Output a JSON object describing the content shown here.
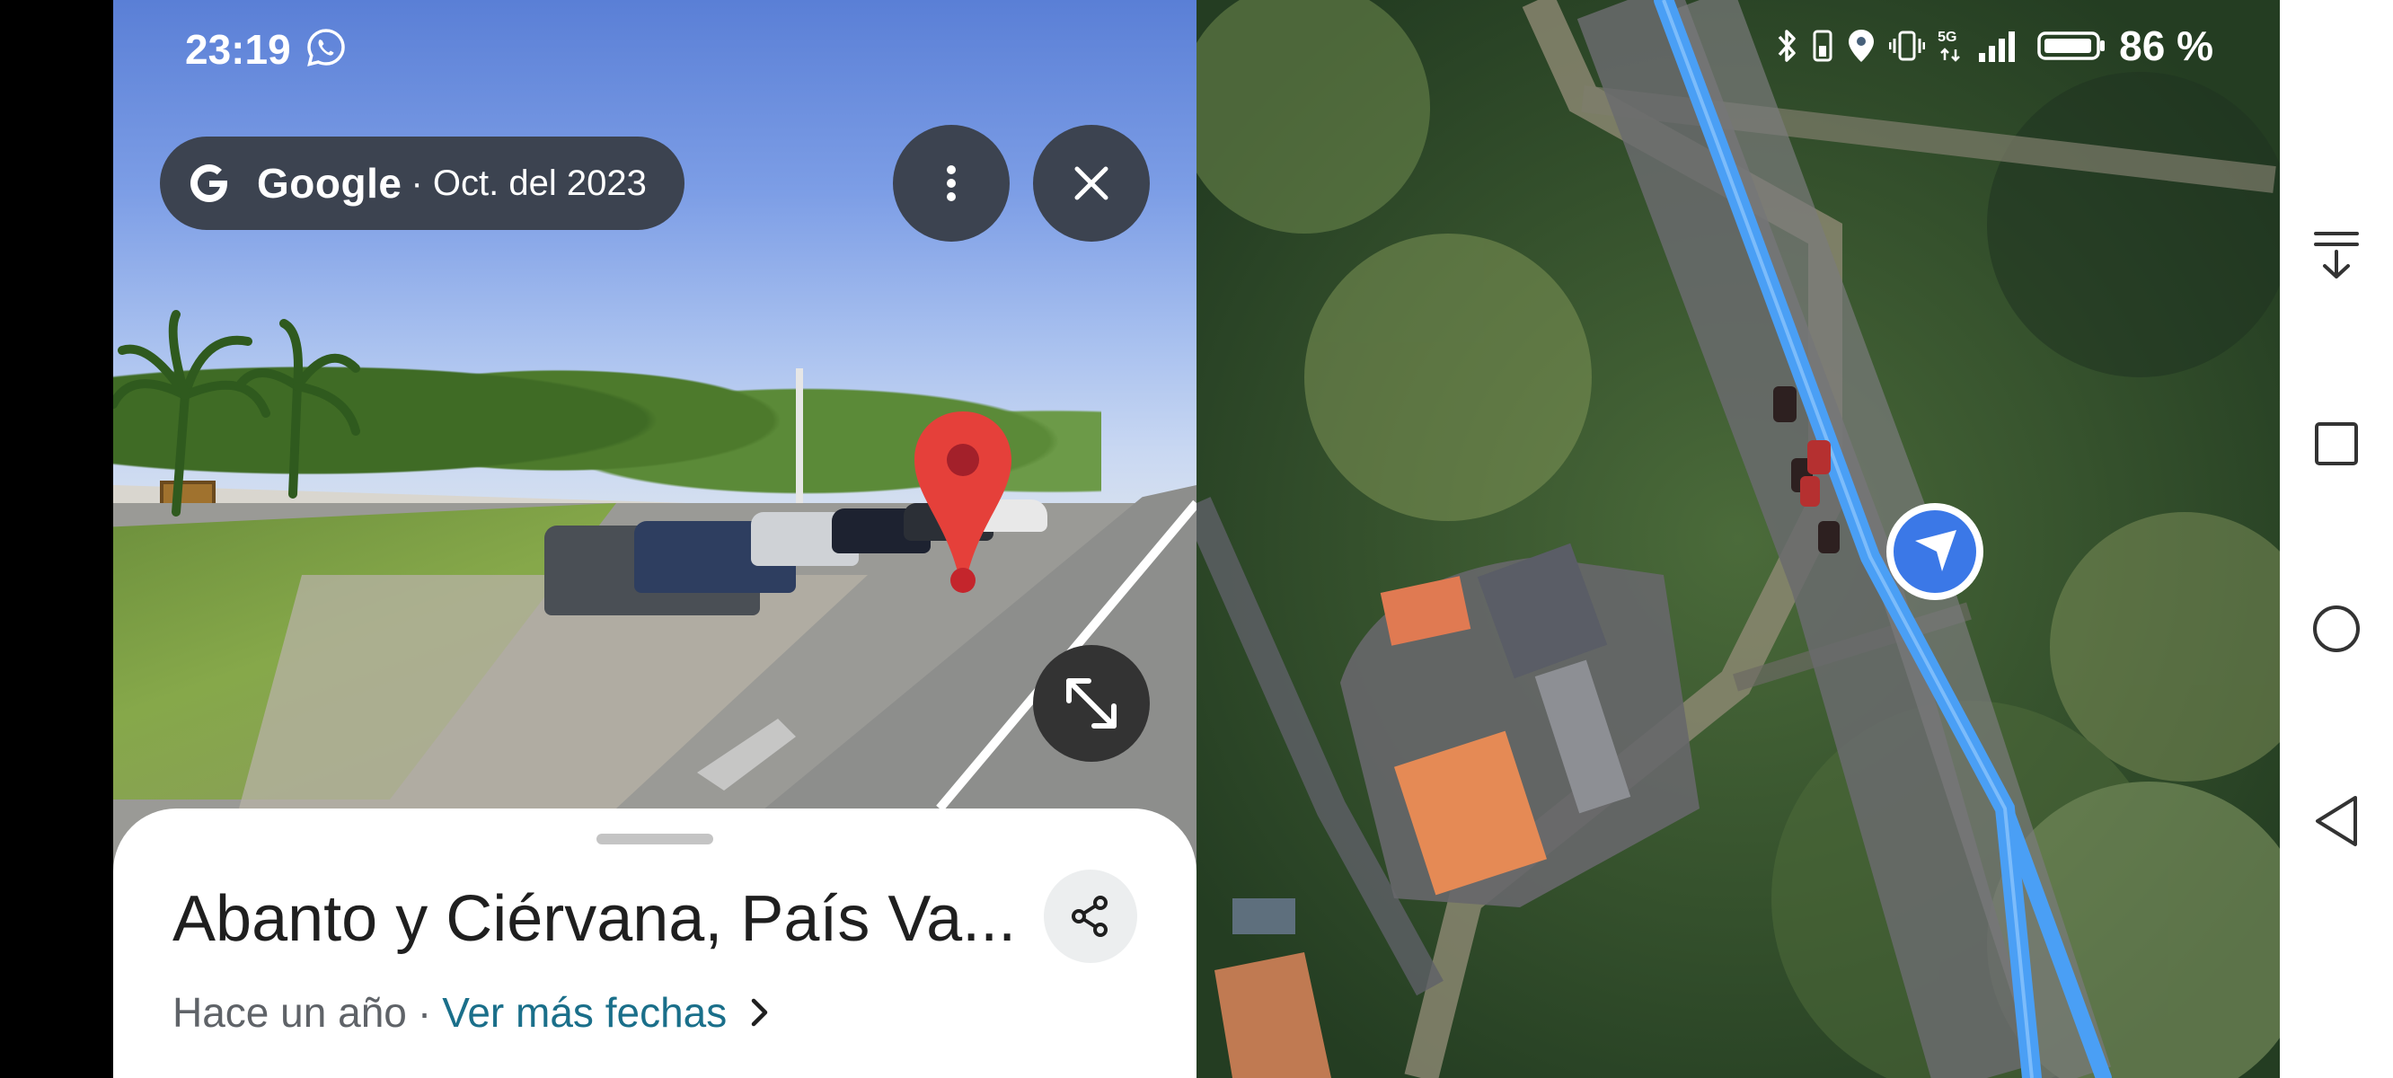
{
  "status_bar": {
    "time": "23:19",
    "battery_percent": "86 %",
    "network": "5G",
    "icons": [
      "whatsapp-icon",
      "bluetooth-icon",
      "location-icon",
      "vibrate-icon",
      "signal-icon",
      "battery-icon"
    ]
  },
  "street_view": {
    "provider": "Google",
    "capture_date": "· Oct. del 2023",
    "more_options_icon": "more-vert-icon",
    "close_icon": "close-icon",
    "expand_icon": "expand-icon",
    "pin_color": "#e5403a"
  },
  "sheet": {
    "place_name": "Abanto y Ciérvana, País Va...",
    "time_ago": "Hace un año",
    "separator": "·",
    "more_dates_link": "Ver más fechas",
    "share_icon": "share-icon"
  },
  "map": {
    "view": "satellite",
    "route_color": "#4a9ff5",
    "location_marker_color": "#3b78e7"
  },
  "nav_bar": {
    "items": [
      "notification-pull-icon",
      "recents-icon",
      "home-icon",
      "back-icon"
    ]
  },
  "colors": {
    "chip_bg": "#3c4350",
    "link": "#1a6f8a"
  }
}
